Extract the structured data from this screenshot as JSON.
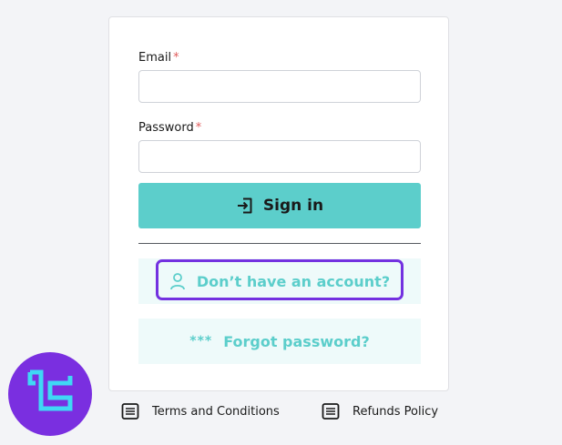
{
  "form": {
    "email_label": "Email",
    "password_label": "Password",
    "required_mark": "*",
    "email_value": "",
    "password_value": "",
    "sign_in_label": "Sign in",
    "no_account_label": "Don’t have an account?",
    "forgot_mask": "***",
    "forgot_label": "Forgot password?"
  },
  "footer": {
    "terms_label": "Terms and Conditions",
    "refunds_label": "Refunds Policy"
  },
  "colors": {
    "accent": "#5ccecb",
    "highlight": "#7331e0",
    "logo_bg": "#7a2fe0",
    "logo_fg": "#3fd8f5",
    "required": "#e05b5b"
  },
  "icons": {
    "sign_in": "sign-in-icon",
    "user": "user-icon",
    "key": "key-mask-icon",
    "document": "document-icon",
    "logo": "brand-logo-icon"
  }
}
